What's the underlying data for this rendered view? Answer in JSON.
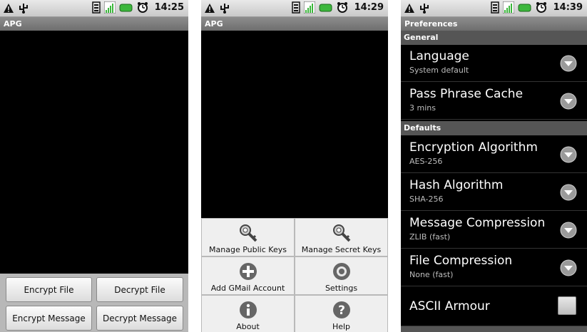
{
  "screens": [
    {
      "status": {
        "time": "14:25"
      },
      "title": "APG",
      "buttons": {
        "encrypt_file": "Encrypt File",
        "decrypt_file": "Decrypt File",
        "encrypt_message": "Encrypt Message",
        "decrypt_message": "Decrypt Message"
      }
    },
    {
      "status": {
        "time": "14:29"
      },
      "title": "APG",
      "menu": {
        "manage_public_keys": "Manage Public Keys",
        "manage_secret_keys": "Manage Secret Keys",
        "add_gmail_account": "Add GMail Account",
        "settings": "Settings",
        "about": "About",
        "help": "Help"
      }
    },
    {
      "status": {
        "time": "14:39"
      },
      "title": "Preferences",
      "sections": {
        "general": "General",
        "defaults": "Defaults"
      },
      "prefs": {
        "language": {
          "title": "Language",
          "value": "System default"
        },
        "pass_phrase_cache": {
          "title": "Pass Phrase Cache",
          "value": "3 mins"
        },
        "encryption_algorithm": {
          "title": "Encryption Algorithm",
          "value": "AES-256"
        },
        "hash_algorithm": {
          "title": "Hash Algorithm",
          "value": "SHA-256"
        },
        "message_compression": {
          "title": "Message Compression",
          "value": "ZLIB (fast)"
        },
        "file_compression": {
          "title": "File Compression",
          "value": "None (fast)"
        },
        "ascii_armour": {
          "title": "ASCII Armour"
        }
      }
    }
  ],
  "colors": {
    "status_bg": "#d6d6d6",
    "title_bg": "#7d7d7d",
    "battery": "#3cb73c",
    "section_bg": "#555555"
  },
  "icons": [
    "warning-icon",
    "usb-icon",
    "sim-icon",
    "signal-icon",
    "battery-icon",
    "alarm-icon",
    "key-icon",
    "plus-icon",
    "gear-icon",
    "info-icon",
    "help-icon",
    "dropdown-icon"
  ]
}
